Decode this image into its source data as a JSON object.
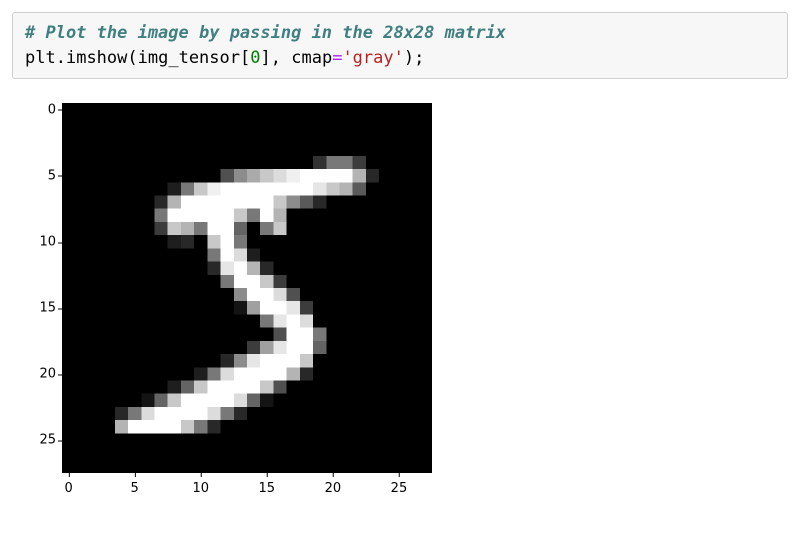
{
  "code": {
    "comment": "# Plot the image by passing in the 28x28 matrix",
    "fn_module": "plt",
    "fn_name": "imshow",
    "arg_var": "img_tensor",
    "arg_index": "0",
    "kwarg_name": "cmap",
    "op_equals": "=",
    "kwarg_value": "'gray'",
    "terminator": ";"
  },
  "chart_data": {
    "type": "heatmap",
    "title": "",
    "xlabel": "",
    "ylabel": "",
    "xlim": [
      -0.5,
      27.5
    ],
    "ylim": [
      27.5,
      -0.5
    ],
    "xticks": [
      0,
      5,
      10,
      15,
      20,
      25
    ],
    "yticks": [
      0,
      5,
      10,
      15,
      20,
      25
    ],
    "cmap": "gray",
    "shape": [
      28,
      28
    ],
    "values": [
      [
        0,
        0,
        0,
        0,
        0,
        0,
        0,
        0,
        0,
        0,
        0,
        0,
        0,
        0,
        0,
        0,
        0,
        0,
        0,
        0,
        0,
        0,
        0,
        0,
        0,
        0,
        0,
        0
      ],
      [
        0,
        0,
        0,
        0,
        0,
        0,
        0,
        0,
        0,
        0,
        0,
        0,
        0,
        0,
        0,
        0,
        0,
        0,
        0,
        0,
        0,
        0,
        0,
        0,
        0,
        0,
        0,
        0
      ],
      [
        0,
        0,
        0,
        0,
        0,
        0,
        0,
        0,
        0,
        0,
        0,
        0,
        0,
        0,
        0,
        0,
        0,
        0,
        0,
        0,
        0,
        0,
        0,
        0,
        0,
        0,
        0,
        0
      ],
      [
        0,
        0,
        0,
        0,
        0,
        0,
        0,
        0,
        0,
        0,
        0,
        0,
        0,
        0,
        0,
        0,
        0,
        0,
        0,
        0,
        0,
        0,
        0,
        0,
        0,
        0,
        0,
        0
      ],
      [
        0,
        0,
        0,
        0,
        0,
        0,
        0,
        0,
        0,
        0,
        0,
        0,
        0,
        0,
        0,
        0,
        0,
        0,
        0,
        50,
        120,
        120,
        60,
        0,
        0,
        0,
        0,
        0
      ],
      [
        0,
        0,
        0,
        0,
        0,
        0,
        0,
        0,
        0,
        0,
        0,
        0,
        80,
        140,
        170,
        200,
        220,
        240,
        255,
        255,
        255,
        255,
        180,
        40,
        0,
        0,
        0,
        0
      ],
      [
        0,
        0,
        0,
        0,
        0,
        0,
        0,
        0,
        30,
        120,
        200,
        240,
        255,
        255,
        255,
        255,
        255,
        255,
        255,
        230,
        200,
        180,
        90,
        0,
        0,
        0,
        0,
        0
      ],
      [
        0,
        0,
        0,
        0,
        0,
        0,
        0,
        40,
        180,
        255,
        255,
        255,
        255,
        255,
        255,
        255,
        200,
        140,
        90,
        40,
        0,
        0,
        0,
        0,
        0,
        0,
        0,
        0
      ],
      [
        0,
        0,
        0,
        0,
        0,
        0,
        0,
        120,
        255,
        255,
        255,
        255,
        255,
        200,
        120,
        255,
        180,
        0,
        0,
        0,
        0,
        0,
        0,
        0,
        0,
        0,
        0,
        0
      ],
      [
        0,
        0,
        0,
        0,
        0,
        0,
        0,
        60,
        200,
        180,
        120,
        255,
        255,
        100,
        0,
        120,
        200,
        0,
        0,
        0,
        0,
        0,
        0,
        0,
        0,
        0,
        0,
        0
      ],
      [
        0,
        0,
        0,
        0,
        0,
        0,
        0,
        0,
        30,
        40,
        0,
        200,
        255,
        120,
        0,
        0,
        0,
        0,
        0,
        0,
        0,
        0,
        0,
        0,
        0,
        0,
        0,
        0
      ],
      [
        0,
        0,
        0,
        0,
        0,
        0,
        0,
        0,
        0,
        0,
        0,
        120,
        255,
        220,
        30,
        0,
        0,
        0,
        0,
        0,
        0,
        0,
        0,
        0,
        0,
        0,
        0,
        0
      ],
      [
        0,
        0,
        0,
        0,
        0,
        0,
        0,
        0,
        0,
        0,
        0,
        40,
        230,
        255,
        180,
        40,
        0,
        0,
        0,
        0,
        0,
        0,
        0,
        0,
        0,
        0,
        0,
        0
      ],
      [
        0,
        0,
        0,
        0,
        0,
        0,
        0,
        0,
        0,
        0,
        0,
        0,
        120,
        255,
        255,
        200,
        60,
        0,
        0,
        0,
        0,
        0,
        0,
        0,
        0,
        0,
        0,
        0
      ],
      [
        0,
        0,
        0,
        0,
        0,
        0,
        0,
        0,
        0,
        0,
        0,
        0,
        0,
        140,
        255,
        255,
        220,
        80,
        0,
        0,
        0,
        0,
        0,
        0,
        0,
        0,
        0,
        0
      ],
      [
        0,
        0,
        0,
        0,
        0,
        0,
        0,
        0,
        0,
        0,
        0,
        0,
        0,
        20,
        160,
        255,
        255,
        230,
        60,
        0,
        0,
        0,
        0,
        0,
        0,
        0,
        0,
        0
      ],
      [
        0,
        0,
        0,
        0,
        0,
        0,
        0,
        0,
        0,
        0,
        0,
        0,
        0,
        0,
        0,
        120,
        230,
        255,
        220,
        0,
        0,
        0,
        0,
        0,
        0,
        0,
        0,
        0
      ],
      [
        0,
        0,
        0,
        0,
        0,
        0,
        0,
        0,
        0,
        0,
        0,
        0,
        0,
        0,
        0,
        0,
        80,
        255,
        255,
        120,
        0,
        0,
        0,
        0,
        0,
        0,
        0,
        0
      ],
      [
        0,
        0,
        0,
        0,
        0,
        0,
        0,
        0,
        0,
        0,
        0,
        0,
        0,
        0,
        60,
        160,
        230,
        255,
        255,
        100,
        0,
        0,
        0,
        0,
        0,
        0,
        0,
        0
      ],
      [
        0,
        0,
        0,
        0,
        0,
        0,
        0,
        0,
        0,
        0,
        0,
        0,
        40,
        140,
        230,
        255,
        255,
        255,
        200,
        0,
        0,
        0,
        0,
        0,
        0,
        0,
        0,
        0
      ],
      [
        0,
        0,
        0,
        0,
        0,
        0,
        0,
        0,
        0,
        0,
        30,
        120,
        220,
        255,
        255,
        255,
        255,
        180,
        40,
        0,
        0,
        0,
        0,
        0,
        0,
        0,
        0,
        0
      ],
      [
        0,
        0,
        0,
        0,
        0,
        0,
        0,
        0,
        30,
        100,
        200,
        255,
        255,
        255,
        255,
        200,
        80,
        0,
        0,
        0,
        0,
        0,
        0,
        0,
        0,
        0,
        0,
        0
      ],
      [
        0,
        0,
        0,
        0,
        0,
        0,
        20,
        100,
        200,
        255,
        255,
        255,
        255,
        220,
        100,
        20,
        0,
        0,
        0,
        0,
        0,
        0,
        0,
        0,
        0,
        0,
        0,
        0
      ],
      [
        0,
        0,
        0,
        0,
        40,
        120,
        220,
        255,
        255,
        255,
        255,
        220,
        120,
        40,
        0,
        0,
        0,
        0,
        0,
        0,
        0,
        0,
        0,
        0,
        0,
        0,
        0,
        0
      ],
      [
        0,
        0,
        0,
        0,
        180,
        255,
        255,
        255,
        255,
        200,
        120,
        40,
        0,
        0,
        0,
        0,
        0,
        0,
        0,
        0,
        0,
        0,
        0,
        0,
        0,
        0,
        0,
        0
      ],
      [
        0,
        0,
        0,
        0,
        0,
        0,
        0,
        0,
        0,
        0,
        0,
        0,
        0,
        0,
        0,
        0,
        0,
        0,
        0,
        0,
        0,
        0,
        0,
        0,
        0,
        0,
        0,
        0
      ],
      [
        0,
        0,
        0,
        0,
        0,
        0,
        0,
        0,
        0,
        0,
        0,
        0,
        0,
        0,
        0,
        0,
        0,
        0,
        0,
        0,
        0,
        0,
        0,
        0,
        0,
        0,
        0,
        0
      ],
      [
        0,
        0,
        0,
        0,
        0,
        0,
        0,
        0,
        0,
        0,
        0,
        0,
        0,
        0,
        0,
        0,
        0,
        0,
        0,
        0,
        0,
        0,
        0,
        0,
        0,
        0,
        0,
        0
      ]
    ]
  }
}
